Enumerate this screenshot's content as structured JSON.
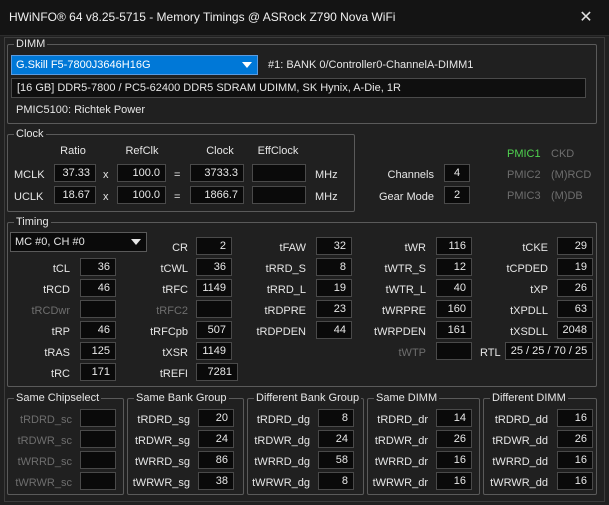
{
  "window": {
    "title": "HWiNFO® 64 v8.25-5715 - Memory Timings @ ASRock Z790 Nova WiFi"
  },
  "dimm": {
    "group_title": "DIMM",
    "module_selected": "G.Skill F5-7800J3646H16G",
    "bank_info": "#1: BANK 0/Controller0-ChannelA-DIMM1",
    "module_desc": "[16 GB] DDR5-7800 / PC5-62400 DDR5 SDRAM UDIMM, SK Hynix, A-Die, 1R",
    "pmic": "PMIC5100: Richtek Power"
  },
  "clock": {
    "group_title": "Clock",
    "headers": {
      "ratio": "Ratio",
      "refclk": "RefClk",
      "clock": "Clock",
      "effclock": "EffClock"
    },
    "mclk": {
      "label": "MCLK",
      "ratio": "37.33",
      "x": "x",
      "refclk": "100.0",
      "eq": "=",
      "clock": "3733.3",
      "effclock": "",
      "unit": "MHz"
    },
    "uclk": {
      "label": "UCLK",
      "ratio": "18.67",
      "x": "x",
      "refclk": "100.0",
      "eq": "=",
      "clock": "1866.7",
      "effclock": "",
      "unit": "MHz"
    },
    "channels_label": "Channels",
    "channels_value": "4",
    "gear_label": "Gear Mode",
    "gear_value": "2"
  },
  "pmic_status": [
    {
      "name": "PMIC1",
      "mode": "CKD"
    },
    {
      "name": "PMIC2",
      "mode": "(M)RCD"
    },
    {
      "name": "PMIC3",
      "mode": "(M)DB"
    }
  ],
  "timing": {
    "group_title": "Timing",
    "channel_selected": "MC #0, CH #0",
    "col1": {
      "tcl": {
        "label": "tCL",
        "value": "36"
      },
      "trcd": {
        "label": "tRCD",
        "value": "46"
      },
      "trcdwr": {
        "label": "tRCDwr",
        "value": ""
      },
      "trp": {
        "label": "tRP",
        "value": "46"
      },
      "tras": {
        "label": "tRAS",
        "value": "125"
      },
      "trc": {
        "label": "tRC",
        "value": "171"
      }
    },
    "col2": {
      "cr": {
        "label": "CR",
        "value": "2"
      },
      "tcwl": {
        "label": "tCWL",
        "value": "36"
      },
      "trfc": {
        "label": "tRFC",
        "value": "1149"
      },
      "trfc2": {
        "label": "tRFC2",
        "value": ""
      },
      "trfcpb": {
        "label": "tRFCpb",
        "value": "507"
      },
      "txsr": {
        "label": "tXSR",
        "value": "1149"
      },
      "trefi": {
        "label": "tREFI",
        "value": "7281"
      }
    },
    "col3": {
      "tfaw": {
        "label": "tFAW",
        "value": "32"
      },
      "trrd_s": {
        "label": "tRRD_S",
        "value": "8"
      },
      "trrd_l": {
        "label": "tRRD_L",
        "value": "19"
      },
      "trdpre": {
        "label": "tRDPRE",
        "value": "23"
      },
      "trdpden": {
        "label": "tRDPDEN",
        "value": "44"
      }
    },
    "col4": {
      "twr": {
        "label": "tWR",
        "value": "116"
      },
      "twtr_s": {
        "label": "tWTR_S",
        "value": "12"
      },
      "twtr_l": {
        "label": "tWTR_L",
        "value": "40"
      },
      "twrpre": {
        "label": "tWRPRE",
        "value": "160"
      },
      "twrpden": {
        "label": "tWRPDEN",
        "value": "161"
      },
      "twtp": {
        "label": "tWTP",
        "value": ""
      }
    },
    "col5": {
      "tcke": {
        "label": "tCKE",
        "value": "29"
      },
      "tcpded": {
        "label": "tCPDED",
        "value": "19"
      },
      "txp": {
        "label": "tXP",
        "value": "26"
      },
      "txpdll": {
        "label": "tXPDLL",
        "value": "63"
      },
      "txsdll": {
        "label": "tXSDLL",
        "value": "2048"
      }
    },
    "rtl": {
      "label": "RTL",
      "value": "25 / 25 / 70 / 25"
    }
  },
  "same_chipselect": {
    "group_title": "Same Chipselect",
    "rows": [
      {
        "label": "tRDRD_sc",
        "value": ""
      },
      {
        "label": "tRDWR_sc",
        "value": ""
      },
      {
        "label": "tWRRD_sc",
        "value": ""
      },
      {
        "label": "tWRWR_sc",
        "value": ""
      }
    ]
  },
  "same_bank_group": {
    "group_title": "Same Bank Group",
    "rows": [
      {
        "label": "tRDRD_sg",
        "value": "20"
      },
      {
        "label": "tRDWR_sg",
        "value": "24"
      },
      {
        "label": "tWRRD_sg",
        "value": "86"
      },
      {
        "label": "tWRWR_sg",
        "value": "38"
      }
    ]
  },
  "different_bank_group": {
    "group_title": "Different Bank Group",
    "rows": [
      {
        "label": "tRDRD_dg",
        "value": "8"
      },
      {
        "label": "tRDWR_dg",
        "value": "24"
      },
      {
        "label": "tWRRD_dg",
        "value": "58"
      },
      {
        "label": "tWRWR_dg",
        "value": "8"
      }
    ]
  },
  "same_dimm": {
    "group_title": "Same DIMM",
    "rows": [
      {
        "label": "tRDRD_dr",
        "value": "14"
      },
      {
        "label": "tRDWR_dr",
        "value": "26"
      },
      {
        "label": "tWRRD_dr",
        "value": "16"
      },
      {
        "label": "tWRWR_dr",
        "value": "16"
      }
    ]
  },
  "different_dimm": {
    "group_title": "Different DIMM",
    "rows": [
      {
        "label": "tRDRD_dd",
        "value": "16"
      },
      {
        "label": "tRDWR_dd",
        "value": "26"
      },
      {
        "label": "tWRRD_dd",
        "value": "16"
      },
      {
        "label": "tWRWR_dd",
        "value": "16"
      }
    ]
  }
}
